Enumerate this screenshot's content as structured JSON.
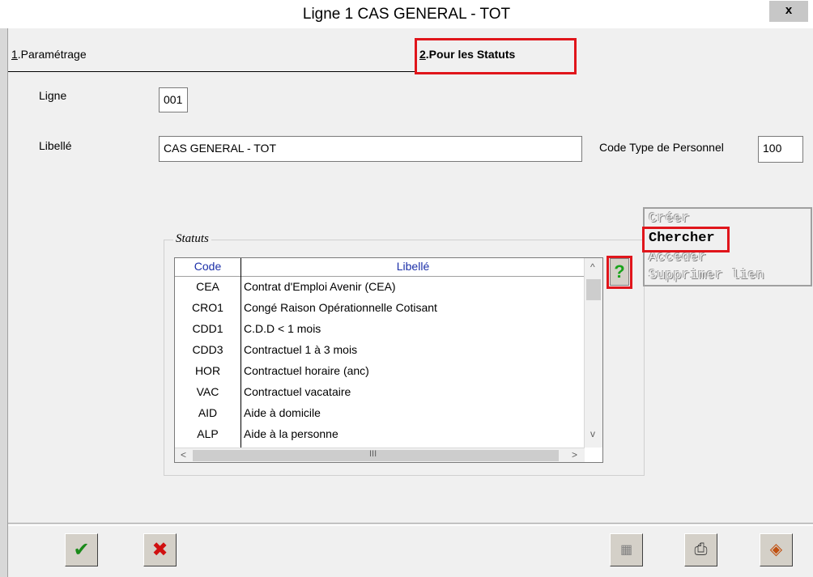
{
  "window": {
    "title": "Ligne 1 CAS GENERAL - TOT",
    "close_label": "x"
  },
  "tabs": [
    {
      "accel": "1",
      "label": ".Paramétrage"
    },
    {
      "accel": "2",
      "label": ".Pour les Statuts"
    }
  ],
  "form": {
    "ligne_label": "Ligne",
    "ligne_value": "001",
    "libelle_label": "Libellé",
    "libelle_value": "CAS GENERAL - TOT",
    "code_type_label": "Code Type de Personnel",
    "code_type_value": "100"
  },
  "statuts": {
    "legend": "Statuts",
    "columns": [
      "Code",
      "Libellé"
    ],
    "rows": [
      {
        "code": "CEA",
        "libelle": "Contrat d'Emploi Avenir (CEA)"
      },
      {
        "code": "CRO1",
        "libelle": "Congé Raison Opérationnelle Cotisant"
      },
      {
        "code": "CDD1",
        "libelle": "C.D.D < 1 mois"
      },
      {
        "code": "CDD3",
        "libelle": "Contractuel 1 à 3 mois"
      },
      {
        "code": "HOR",
        "libelle": "Contractuel horaire (anc)"
      },
      {
        "code": "VAC",
        "libelle": "Contractuel vacataire"
      },
      {
        "code": "AID",
        "libelle": "Aide à domicile"
      },
      {
        "code": "ALP",
        "libelle": "Aide à la personne"
      }
    ],
    "scroll_up": "^",
    "scroll_down": "v",
    "scroll_left": "<",
    "scroll_right": ">",
    "hthumb_grip": "III",
    "help_label": "?"
  },
  "context_menu": {
    "items": [
      {
        "label": "Créer",
        "enabled": false
      },
      {
        "label": "Chercher",
        "enabled": true
      },
      {
        "label": "Accéder",
        "enabled": false
      },
      {
        "label": "Supprimer lien",
        "enabled": false
      }
    ]
  },
  "toolbar": {
    "ok_icon": "checkmark-icon",
    "cancel_icon": "cross-icon",
    "calculator_icon": "calculator-icon",
    "print_icon": "printer-icon",
    "exit_icon": "exit-icon"
  },
  "colors": {
    "highlight": "#e0151b",
    "header_text": "#1b2fa8",
    "help_green": "#1aa31a"
  }
}
